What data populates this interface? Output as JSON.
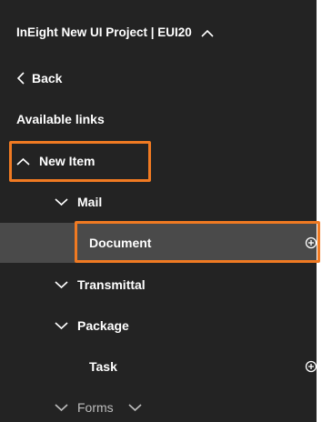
{
  "nav": {
    "project_title": "InEight New UI Project | EUI20",
    "back_label": "Back",
    "section_label": "Available links",
    "items": [
      {
        "label": "New Item"
      },
      {
        "label": "Mail"
      },
      {
        "label": "Document"
      },
      {
        "label": "Transmittal"
      },
      {
        "label": "Package"
      },
      {
        "label": "Task"
      },
      {
        "label": "Forms"
      }
    ]
  },
  "colors": {
    "panel_bg": "#232323",
    "selected_row_bg": "#4a4a4a",
    "highlight_accent": "#f07a22",
    "text": "#ffffff"
  },
  "icons": [
    "chevron-up-icon",
    "chevron-left-icon",
    "chevron-down-icon",
    "add-circle-icon"
  ]
}
